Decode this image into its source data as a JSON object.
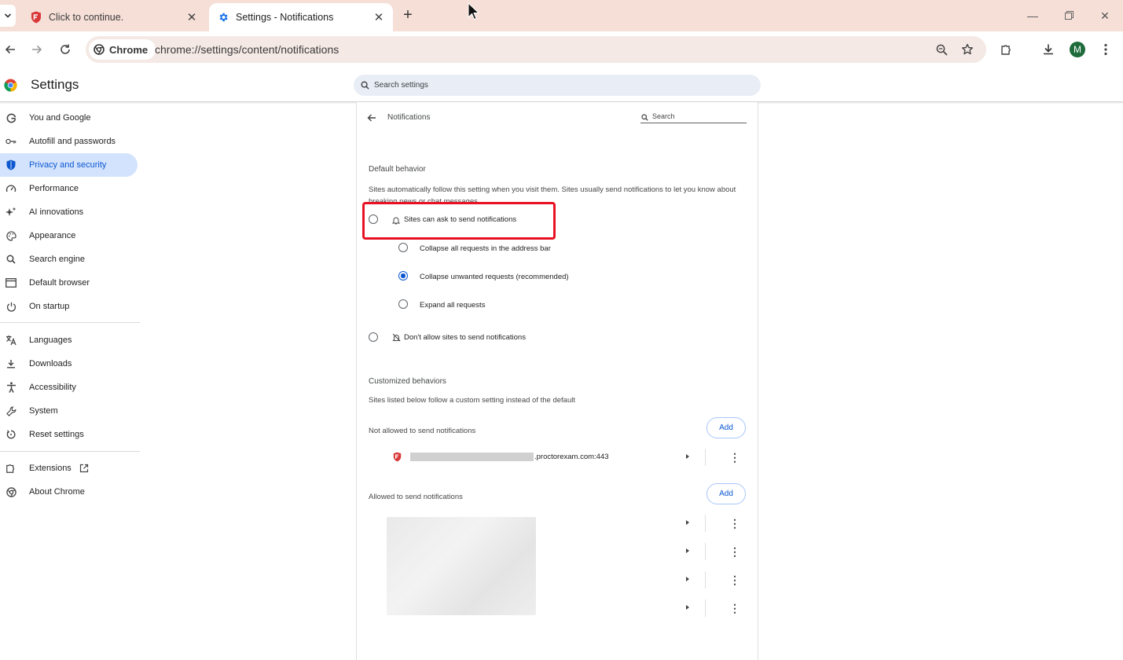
{
  "browser": {
    "tabs": [
      {
        "title": "Click to continue.",
        "icon": "proctor-shield-icon",
        "active": false
      },
      {
        "title": "Settings - Notifications",
        "icon": "gear-icon",
        "active": true
      }
    ],
    "chip_label": "Chrome",
    "url": "chrome://settings/content/notifications",
    "avatar_letter": "M"
  },
  "settings": {
    "title": "Settings",
    "search_placeholder": "Search settings",
    "nav_items": [
      {
        "label": "You and Google",
        "icon": "google-g-icon",
        "active": false
      },
      {
        "label": "Autofill and passwords",
        "icon": "key-icon",
        "active": false
      },
      {
        "label": "Privacy and security",
        "icon": "shield-icon",
        "active": true
      },
      {
        "label": "Performance",
        "icon": "speedometer-icon",
        "active": false
      },
      {
        "label": "AI innovations",
        "icon": "sparkle-icon",
        "active": false
      },
      {
        "label": "Appearance",
        "icon": "palette-icon",
        "active": false
      },
      {
        "label": "Search engine",
        "icon": "search-icon",
        "active": false
      },
      {
        "label": "Default browser",
        "icon": "browser-window-icon",
        "active": false
      },
      {
        "label": "On startup",
        "icon": "power-icon",
        "active": false
      },
      {
        "label": "Languages",
        "icon": "translate-icon",
        "active": false
      },
      {
        "label": "Downloads",
        "icon": "download-icon",
        "active": false
      },
      {
        "label": "Accessibility",
        "icon": "accessibility-icon",
        "active": false
      },
      {
        "label": "System",
        "icon": "wrench-icon",
        "active": false
      },
      {
        "label": "Reset settings",
        "icon": "reset-icon",
        "active": false
      },
      {
        "label": "Extensions",
        "icon": "puzzle-icon",
        "active": false
      },
      {
        "label": "About Chrome",
        "icon": "chrome-icon",
        "active": false
      }
    ]
  },
  "notifications": {
    "page_title": "Notifications",
    "search_label": "Search",
    "default_behavior": {
      "heading": "Default behavior",
      "description": "Sites automatically follow this setting when you visit them. Sites usually send notifications to let you know about breaking news or chat messages",
      "options": {
        "allow_ask": {
          "label": "Sites can ask to send notifications",
          "selected": false
        },
        "collapse_all": {
          "label": "Collapse all requests in the address bar",
          "selected": false
        },
        "collapse_unwanted": {
          "label": "Collapse unwanted requests (recommended)",
          "selected": true
        },
        "expand_all": {
          "label": "Expand all requests",
          "selected": false
        },
        "block": {
          "label": "Don't allow sites to send notifications",
          "selected": false
        }
      }
    },
    "customized": {
      "heading": "Customized behaviors",
      "description": "Sites listed below follow a custom setting instead of the default",
      "not_allowed": {
        "heading": "Not allowed to send notifications",
        "add_label": "Add",
        "sites": [
          {
            "host_suffix": ".proctorexam.com:443"
          }
        ]
      },
      "allowed": {
        "heading": "Allowed to send notifications",
        "add_label": "Add",
        "site_count": 4
      }
    }
  },
  "colors": {
    "accent": "#0b57d0",
    "active_nav_bg": "#d3e3fd",
    "highlight_box": "#e81123",
    "tabstrip_bg": "#f6dfd7"
  }
}
